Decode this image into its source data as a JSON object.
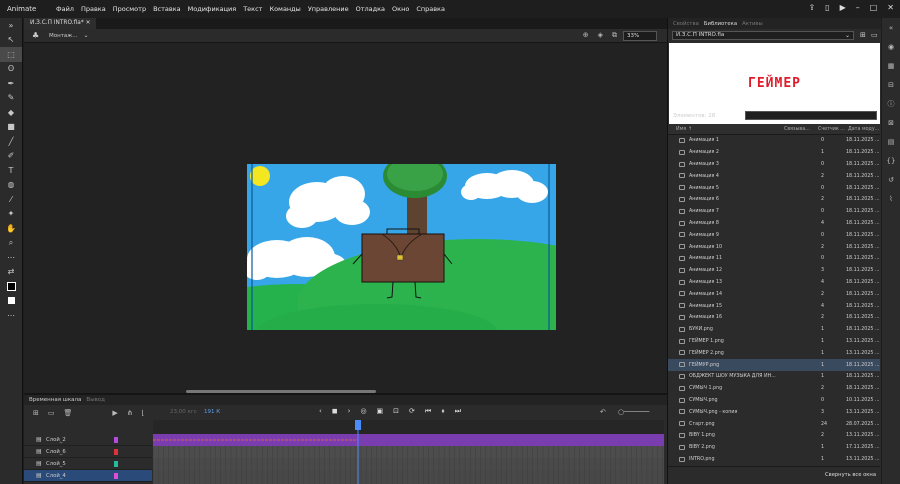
{
  "app": {
    "name": "Animate"
  },
  "menu": [
    "Файл",
    "Правка",
    "Просмотр",
    "Вставка",
    "Модификация",
    "Текст",
    "Команды",
    "Управление",
    "Отладка",
    "Окно",
    "Справка"
  ],
  "document": {
    "tab": "И.З.С.П INTRO.fla*",
    "scene": "Монтаж...",
    "zoom": "33%"
  },
  "timeline": {
    "tabs": [
      "Временная шкала",
      "Вывод"
    ],
    "fps": "23,00",
    "fps_unit": "кгс",
    "frame": "191",
    "frame_unit": "К",
    "ruler": [
      "140",
      "145",
      "150",
      "155",
      "160",
      "165",
      "170",
      "175",
      "180",
      "185",
      "190",
      "195",
      "200",
      "205",
      "210",
      "215",
      "220",
      "225",
      "230",
      "235",
      "240",
      "245",
      "250",
      "255",
      "260",
      "265",
      "270",
      "275"
    ],
    "ruler_secs": [
      "6с",
      "7с",
      "8с",
      "9с",
      "10с",
      "11с"
    ],
    "playhead_frame": 191,
    "layers": [
      {
        "name": "Слой_2",
        "color": "#b44be0"
      },
      {
        "name": "Слой_6",
        "color": "#e0323c"
      },
      {
        "name": "Слой_5",
        "color": "#29b8a0"
      },
      {
        "name": "Слой_4",
        "color": "#e04bd8"
      }
    ]
  },
  "panel": {
    "tabs": [
      "Свойства",
      "Библиотека",
      "Активы"
    ],
    "library_name": "И.З.С.П INTRO.fla",
    "preview_text": "ГЕЙМЕР",
    "count": "Элементов: 28",
    "headers": {
      "name": "Имя",
      "link": "Связыва...",
      "count": "Счетчик ...",
      "date": "Дата моду..."
    },
    "items": [
      {
        "name": "Анимация 1",
        "link": "",
        "count": "0",
        "date": "18.11.2025 ..."
      },
      {
        "name": "Анимация 2",
        "link": "",
        "count": "1",
        "date": "18.11.2025 ..."
      },
      {
        "name": "Анимация 3",
        "link": "",
        "count": "0",
        "date": "18.11.2025 ..."
      },
      {
        "name": "Анимация 4",
        "link": "",
        "count": "2",
        "date": "18.11.2025 ..."
      },
      {
        "name": "Анимация 5",
        "link": "",
        "count": "0",
        "date": "18.11.2025 ..."
      },
      {
        "name": "Анимация 6",
        "link": "",
        "count": "2",
        "date": "18.11.2025 ..."
      },
      {
        "name": "Анимация 7",
        "link": "",
        "count": "0",
        "date": "18.11.2025 ..."
      },
      {
        "name": "Анимация 8",
        "link": "",
        "count": "4",
        "date": "18.11.2025 ..."
      },
      {
        "name": "Анимация 9",
        "link": "",
        "count": "0",
        "date": "18.11.2025 ..."
      },
      {
        "name": "Анимация 10",
        "link": "",
        "count": "2",
        "date": "18.11.2025 ..."
      },
      {
        "name": "Анимация 11",
        "link": "",
        "count": "0",
        "date": "18.11.2025 ..."
      },
      {
        "name": "Анимация 12",
        "link": "",
        "count": "3",
        "date": "18.11.2025 ..."
      },
      {
        "name": "Анимация 13",
        "link": "",
        "count": "4",
        "date": "18.11.2025 ..."
      },
      {
        "name": "Анимация 14",
        "link": "",
        "count": "2",
        "date": "18.11.2025 ..."
      },
      {
        "name": "Анимация 15",
        "link": "",
        "count": "4",
        "date": "18.11.2025 ..."
      },
      {
        "name": "Анимация 16",
        "link": "",
        "count": "2",
        "date": "18.11.2025 ..."
      },
      {
        "name": "БУКИ.png",
        "link": "",
        "count": "1",
        "date": "18.11.2025 ..."
      },
      {
        "name": "ГЕЙМЕР 1.png",
        "link": "",
        "count": "1",
        "date": "13.11.2025 ..."
      },
      {
        "name": "ГЕЙМЕР 2.png",
        "link": "",
        "count": "1",
        "date": "13.11.2025 ..."
      },
      {
        "name": "ГЕЙМУР.png",
        "link": "",
        "count": "1",
        "date": "18.11.2025 ..."
      },
      {
        "name": "ОБДЖЕКТ ШОУ МУЗЫКА ДЛЯ ИН...",
        "link": "",
        "count": "1",
        "date": "18.11.2025 ..."
      },
      {
        "name": "СУМЫЧ 1.png",
        "link": "",
        "count": "2",
        "date": "18.11.2025 ..."
      },
      {
        "name": "СУМЫЧ.png",
        "link": "",
        "count": "0",
        "date": "10.11.2025 ..."
      },
      {
        "name": "СУМЫЧ.png - копия",
        "link": "",
        "count": "3",
        "date": "13.11.2025 ..."
      },
      {
        "name": "Старт.png",
        "link": "",
        "count": "24",
        "date": "28.07.2025 ..."
      },
      {
        "name": "BIBY 1.png",
        "link": "",
        "count": "2",
        "date": "13.11.2025 ..."
      },
      {
        "name": "BIBY 2.png",
        "link": "",
        "count": "1",
        "date": "17.11.2025 ..."
      },
      {
        "name": "INTRO.png",
        "link": "",
        "count": "1",
        "date": "13.11.2025 ..."
      }
    ],
    "selected_index": 19,
    "collapse_label": "Свернуть все окна"
  }
}
